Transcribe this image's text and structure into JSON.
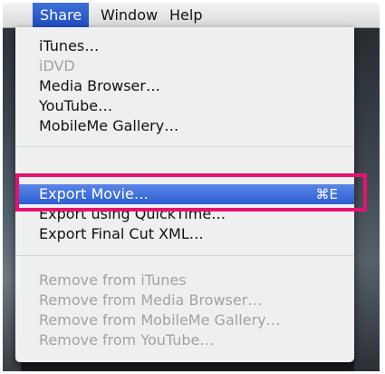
{
  "menubar": {
    "items": [
      {
        "label": "Share"
      },
      {
        "label": "Window"
      },
      {
        "label": "Help"
      }
    ]
  },
  "share_menu": {
    "group1": [
      "iTunes…",
      "iDVD",
      "Media Browser…",
      "YouTube…",
      "MobileMe Gallery…"
    ],
    "export_movie": {
      "label": "Export Movie…",
      "shortcut": "⌘E"
    },
    "group2": [
      "Export using QuickTime…",
      "Export Final Cut XML…"
    ],
    "group3": [
      "Remove from iTunes",
      "Remove from Media Browser…",
      "Remove from MobileMe Gallery…",
      "Remove from YouTube…"
    ]
  },
  "colors": {
    "highlight": "#2c5fd4",
    "annotation": "#e6126e",
    "disabled_text": "#a2a2a2"
  }
}
